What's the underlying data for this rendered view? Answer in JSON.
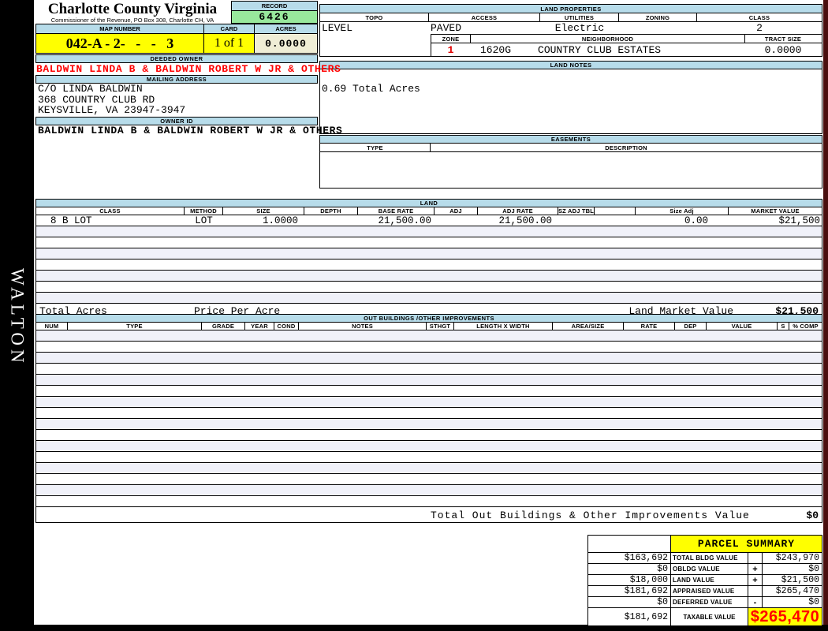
{
  "header": {
    "county_title": "Charlotte County Virginia",
    "commissioner_line": "Commissioner of the Revenue, PO Box 308, Charlotte CH, VA",
    "record_label": "RECORD",
    "record_value": "6426",
    "map_number_label": "MAP NUMBER",
    "map_number_value": "042-A - 2-   -   -   3",
    "card_label": "CARD",
    "card_value": "1 of 1",
    "acres_label": "ACRES",
    "acres_value": "0.0000"
  },
  "owner": {
    "deeded_owner_label": "DEEDED OWNER",
    "deeded_owner": "BALDWIN LINDA B & BALDWIN ROBERT W JR & OTHERS",
    "mailing_address_label": "MAILING ADDRESS",
    "address_lines": [
      "C/O LINDA BALDWIN",
      "368 COUNTRY CLUB RD",
      "KEYSVILLE, VA 23947-3947"
    ],
    "owner_id_label": "OWNER ID",
    "owner_id": "BALDWIN LINDA B & BALDWIN ROBERT W JR & OTHERS"
  },
  "land_properties": {
    "section_label": "LAND PROPERTIES",
    "columns": [
      "TOPO",
      "ACCESS",
      "UTILITIES",
      "ZONING",
      "CLASS"
    ],
    "topo": "LEVEL",
    "access": "PAVED",
    "utilities": "Electric",
    "zoning": "",
    "class": "2",
    "zone_label": "ZONE",
    "zone": "1",
    "neighborhood_label": "NEIGHBORHOOD",
    "neighborhood_code": "1620G",
    "neighborhood": "COUNTRY CLUB ESTATES",
    "tract_size_label": "TRACT SIZE",
    "tract_size": "0.0000"
  },
  "land_notes": {
    "section_label": "LAND NOTES",
    "note": "0.69 Total Acres"
  },
  "easements": {
    "section_label": "EASEMENTS",
    "type_label": "TYPE",
    "description_label": "DESCRIPTION"
  },
  "land": {
    "section_label": "LAND",
    "columns": [
      "CLASS",
      "METHOD",
      "SIZE",
      "DEPTH",
      "BASE RATE",
      "ADJ",
      "ADJ RATE",
      "SZ ADJ TBL",
      "",
      "Size Adj",
      "MARKET VALUE"
    ],
    "row": {
      "class": "8 B LOT",
      "method": "LOT",
      "size": "1.0000",
      "depth": "",
      "base_rate": "21,500.00",
      "adj": "",
      "adj_rate": "21,500.00",
      "sz_adj_tbl": "",
      "size_adj": "0.00",
      "market_value": "$21,500"
    },
    "empty_row_count": 7,
    "total_acres_label": "Total Acres",
    "price_per_acre_label": "Price Per Acre",
    "market_value_label": "Land Market Value",
    "market_value_total": "$21,500"
  },
  "out_buildings": {
    "section_label": "OUT BUILDINGS /OTHER IMPROVEMENTS",
    "columns": [
      "NUM",
      "TYPE",
      "GRADE",
      "YEAR",
      "COND",
      "NOTES",
      "STHGT",
      "LENGTH X WIDTH",
      "AREA/SIZE",
      "RATE",
      "DEP",
      "VALUE",
      "S",
      "% COMP"
    ],
    "empty_row_count": 16,
    "total_label": "Total Out Buildings & Other Improvements Value",
    "total_value": "$0"
  },
  "parcel_summary": {
    "title": "PARCEL SUMMARY",
    "rows": [
      {
        "prior": "$163,692",
        "label": "TOTAL BLDG VALUE",
        "op": "",
        "value": "$243,970"
      },
      {
        "prior": "$0",
        "label": "OBLDG VALUE",
        "op": "+",
        "value": "$0"
      },
      {
        "prior": "$18,000",
        "label": "LAND VALUE",
        "op": "+",
        "value": "$21,500"
      },
      {
        "prior": "$181,692",
        "label": "APPRAISED VALUE",
        "op": "",
        "value": "$265,470"
      },
      {
        "prior": "$0",
        "label": "DEFERRED VALUE",
        "op": "-",
        "value": "$0"
      }
    ],
    "taxable": {
      "prior": "$181,692",
      "label": "TAXABLE VALUE",
      "value": "$265,470"
    }
  },
  "sidebar": {
    "vertical_text": "WALTON"
  },
  "colors": {
    "section_header_bg": "#B7DCEA",
    "highlight_yellow": "#FFFF00",
    "record_green": "#98E89C",
    "acres_beige": "#EFEDD5",
    "alert_red": "#FF0000",
    "owner_red": "#FF0000",
    "alt_row": "#F0F1F9",
    "edge_maroon": "#4A0E0E",
    "frame_black": "#000000"
  }
}
